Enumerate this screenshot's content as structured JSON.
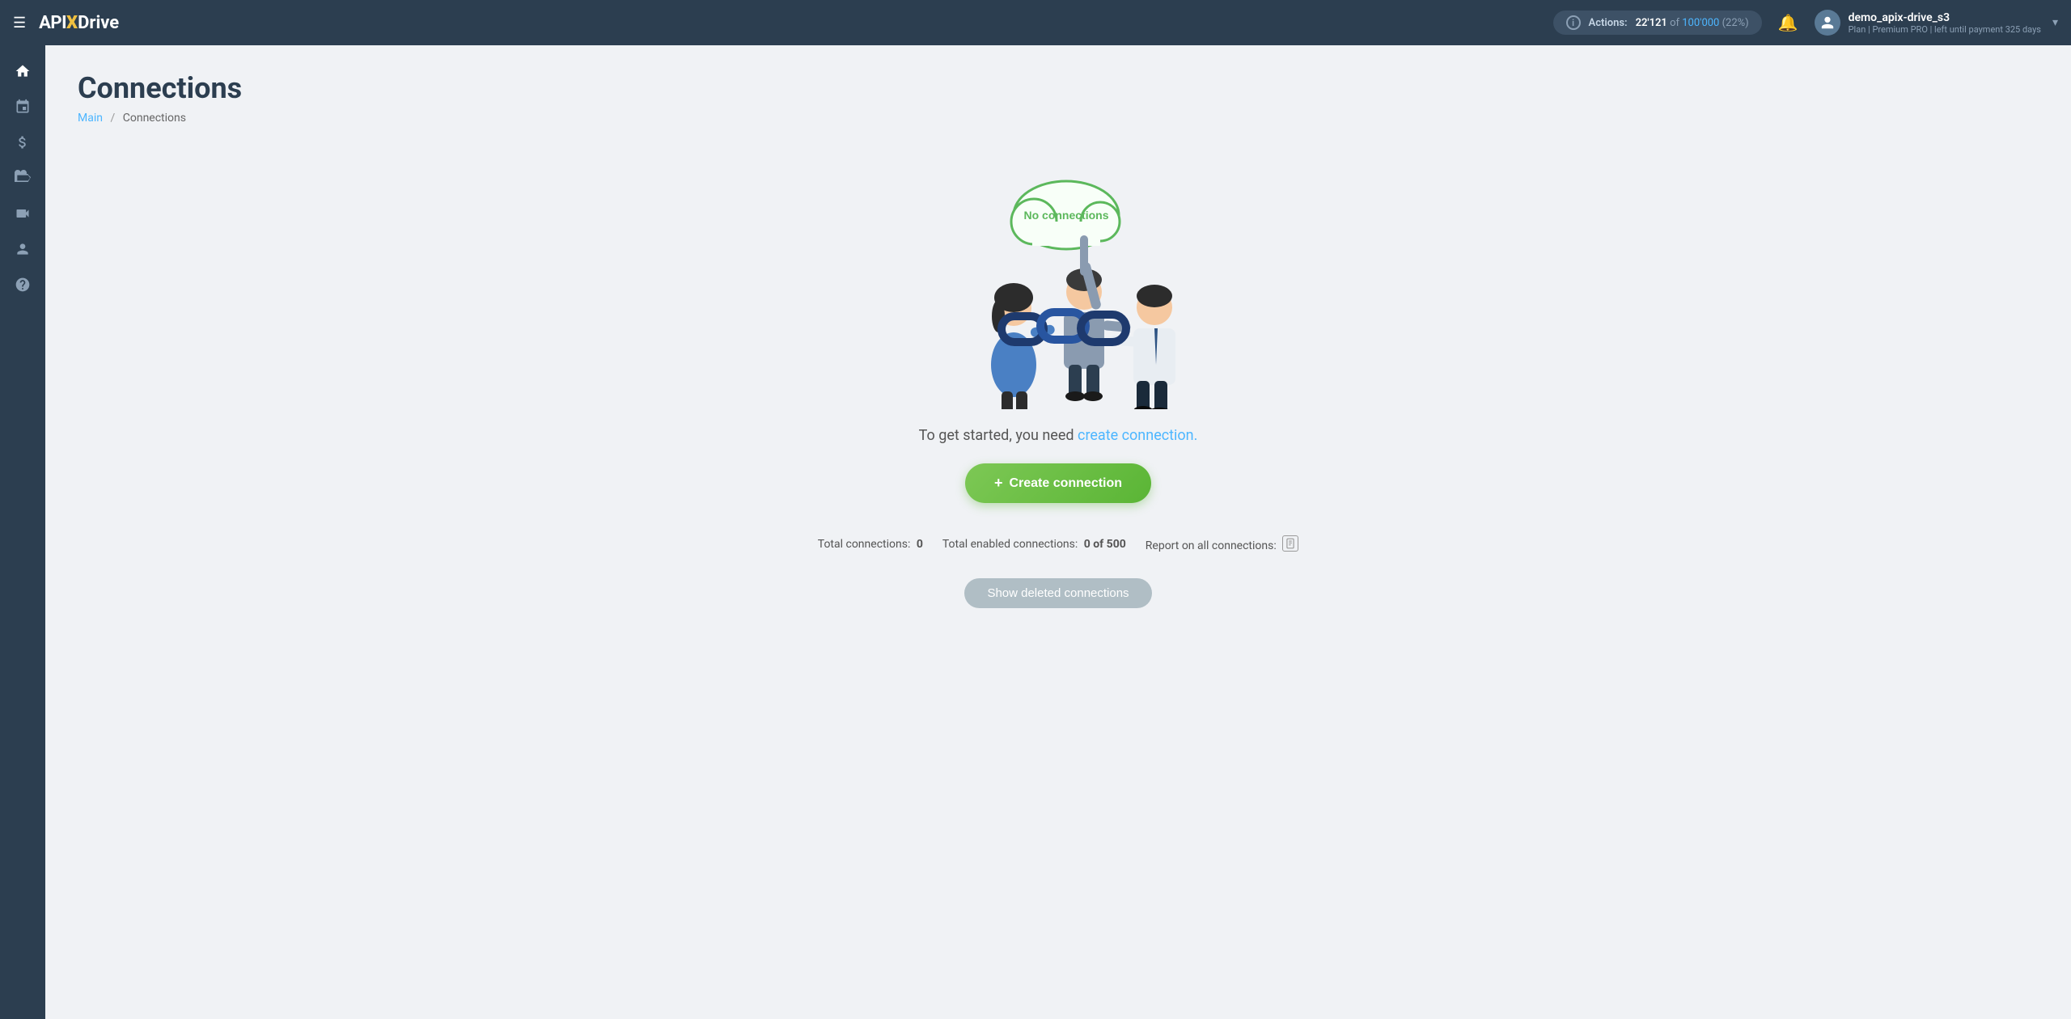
{
  "topnav": {
    "menu_icon": "☰",
    "logo": {
      "api": "API",
      "x": "X",
      "drive": "Drive"
    },
    "actions": {
      "label": "Actions:",
      "used": "22'121",
      "sep": " of ",
      "total": "100'000",
      "pct": "(22%)"
    },
    "bell_icon": "🔔",
    "user": {
      "name": "demo_apix-drive_s3",
      "plan_prefix": "Plan |",
      "plan_name": "Premium PRO",
      "plan_suffix": "| left until payment",
      "days": "325",
      "days_suffix": "days"
    }
  },
  "sidebar": {
    "items": [
      {
        "id": "home",
        "icon": "⌂",
        "label": "Home"
      },
      {
        "id": "connections",
        "icon": "⬡",
        "label": "Connections"
      },
      {
        "id": "billing",
        "icon": "$",
        "label": "Billing"
      },
      {
        "id": "briefcase",
        "icon": "💼",
        "label": "Services"
      },
      {
        "id": "video",
        "icon": "▶",
        "label": "Video"
      },
      {
        "id": "profile",
        "icon": "👤",
        "label": "Profile"
      },
      {
        "id": "help",
        "icon": "?",
        "label": "Help"
      }
    ]
  },
  "page": {
    "title": "Connections",
    "breadcrumb_main": "Main",
    "breadcrumb_sep": "/",
    "breadcrumb_current": "Connections",
    "no_connections_label": "No connections",
    "prompt_text_static": "To get started, you need",
    "prompt_text_link": "create connection.",
    "create_btn_plus": "+",
    "create_btn_label": "Create connection",
    "stats": {
      "total_label": "Total connections:",
      "total_val": "0",
      "enabled_label": "Total enabled connections:",
      "enabled_val": "0 of 500",
      "report_label": "Report on all connections:"
    },
    "show_deleted_label": "Show deleted connections"
  }
}
